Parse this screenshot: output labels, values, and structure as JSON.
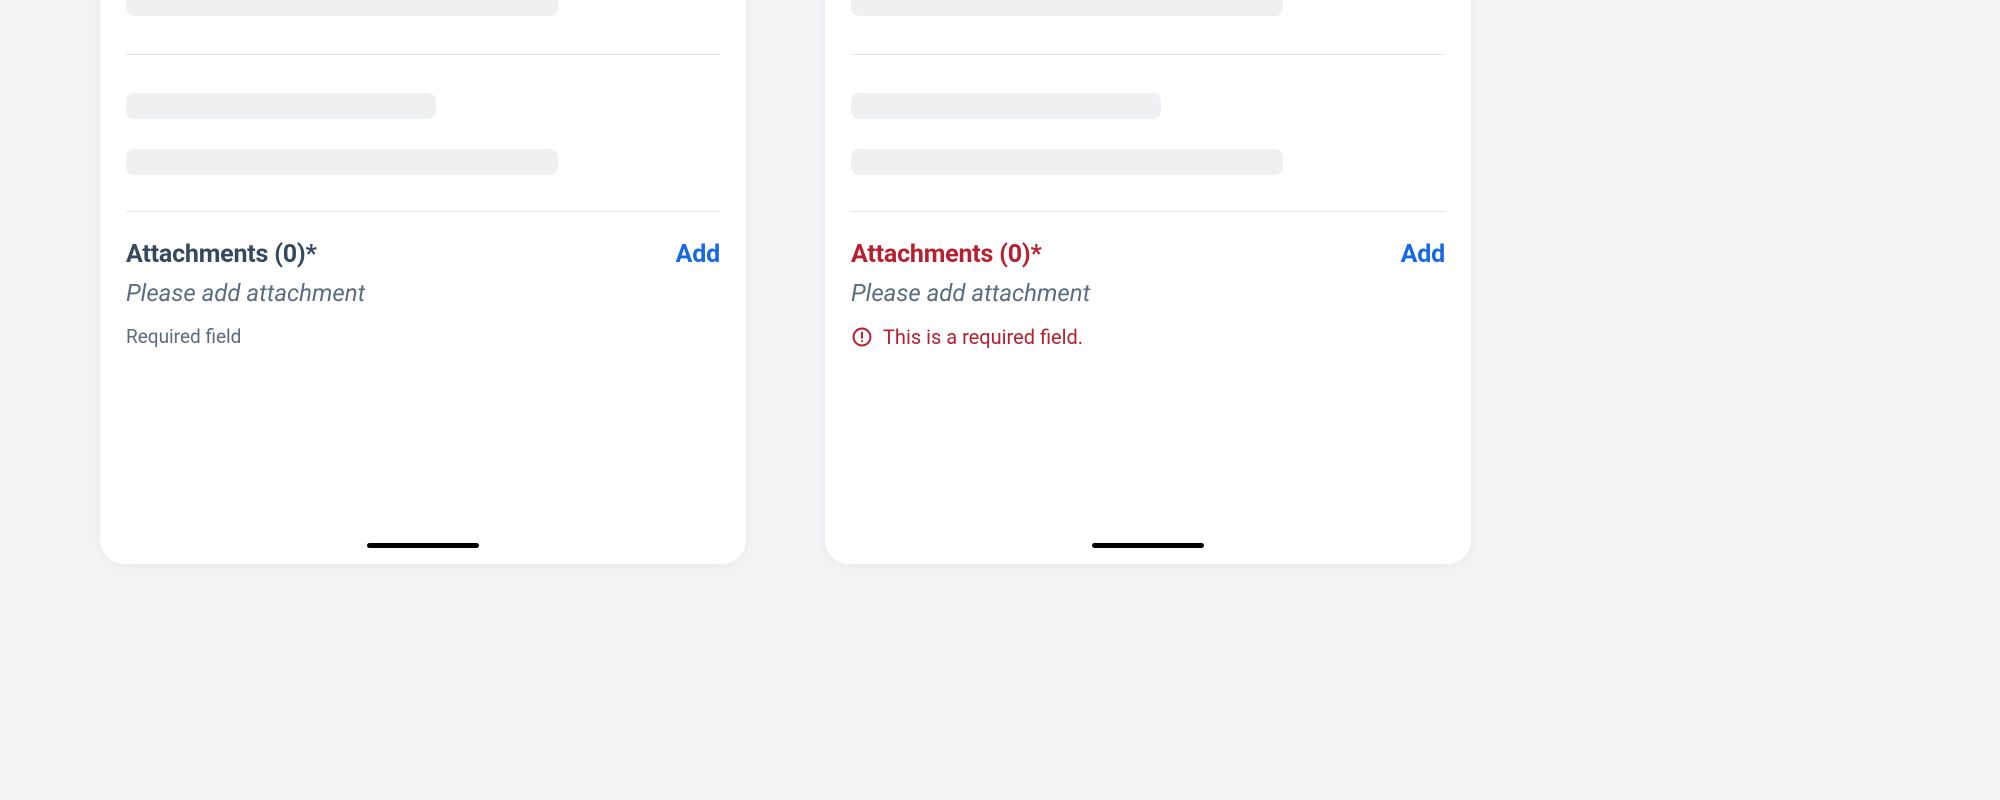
{
  "left": {
    "attachments_title": "Attachments (0)*",
    "add_label": "Add",
    "hint": "Please add attachment",
    "helper": "Required field"
  },
  "right": {
    "attachments_title": "Attachments (0)*",
    "add_label": "Add",
    "hint": "Please add attachment",
    "error": "This is a required field."
  }
}
